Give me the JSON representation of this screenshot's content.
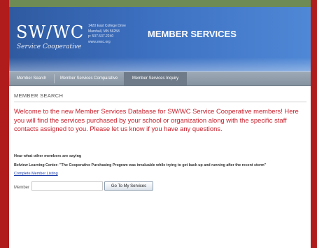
{
  "colors": {
    "frame_red": "#b01c1c",
    "frame_green": "#3d6b3a",
    "banner_blue": "#3c6fc0",
    "nav_gray": "#8592a0",
    "welcome_red": "#c81e2a",
    "link_blue": "#1a3aa8"
  },
  "header": {
    "logo_main": "SW/WC",
    "logo_sub": "Service Cooperative",
    "address_lines": [
      "1420 East College Drive",
      "Marshall, MN 56258",
      "p: 507.537.2240",
      "www.swsc.org"
    ],
    "title": "MEMBER SERVICES"
  },
  "nav": {
    "items": [
      {
        "label": "Member Search",
        "active": false
      },
      {
        "label": "Member Services Comparative",
        "active": false
      },
      {
        "label": "Member Services Inquiry",
        "active": true
      }
    ]
  },
  "main": {
    "section_title": "Member Search",
    "welcome": "Welcome to the new Member Services Database for SW/WC Service Cooperative members! Here you will find the services purchased by your school or organization along with the specific staff contacts assigned to you. Please let us know if you have any questions.",
    "hear_label": "Hear what other members are saying",
    "testimonial": "Belview Learning Center- \"The Cooperative Purchasing Program was invaluable while trying to get back up and running after the recent storm\"",
    "listing_link": "Complete Member Listing",
    "member_label": "Member",
    "member_value": "",
    "go_button": "Go To My Services"
  }
}
